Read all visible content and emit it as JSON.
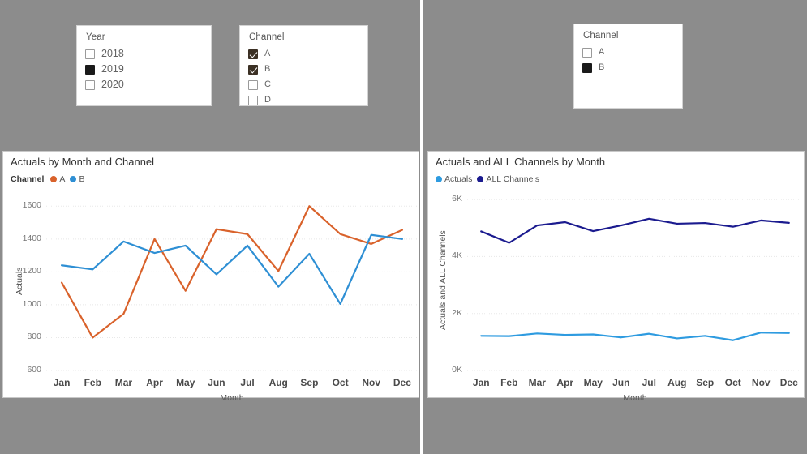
{
  "slicers": {
    "year": {
      "title": "Year",
      "items": [
        {
          "label": "2018",
          "state": "unchecked"
        },
        {
          "label": "2019",
          "state": "filled"
        },
        {
          "label": "2020",
          "state": "unchecked"
        }
      ]
    },
    "channel_left": {
      "title": "Channel",
      "items": [
        {
          "label": "A",
          "state": "checked"
        },
        {
          "label": "B",
          "state": "checked"
        },
        {
          "label": "C",
          "state": "unchecked"
        },
        {
          "label": "D",
          "state": "unchecked"
        }
      ]
    },
    "channel_right": {
      "title": "Channel",
      "items": [
        {
          "label": "A",
          "state": "unchecked"
        },
        {
          "label": "B",
          "state": "filled"
        }
      ]
    }
  },
  "colors": {
    "orange": "#D9622B",
    "blue": "#2E8FD4",
    "navy": "#1B1B8F",
    "lightblue": "#2E9BE0",
    "background": "#8c8c8c",
    "divider": "#ffffff"
  },
  "chart_data": [
    {
      "id": "actuals-by-month-and-channel",
      "type": "line",
      "title": "Actuals by Month and Channel",
      "legend_title": "Channel",
      "legend_position": "top-left",
      "grid": true,
      "xlabel": "Month",
      "ylabel": "Actuals",
      "categories": [
        "Jan",
        "Feb",
        "Mar",
        "Apr",
        "May",
        "Jun",
        "Jul",
        "Aug",
        "Sep",
        "Oct",
        "Nov",
        "Dec"
      ],
      "yticks": [
        600,
        800,
        1000,
        1200,
        1400,
        1600
      ],
      "ylim": [
        600,
        1700
      ],
      "series": [
        {
          "name": "A",
          "color": "#D9622B",
          "values": [
            1135,
            800,
            945,
            1400,
            1085,
            1460,
            1430,
            1205,
            1600,
            1430,
            1370,
            1455
          ]
        },
        {
          "name": "B",
          "color": "#2E8FD4",
          "values": [
            1240,
            1215,
            1385,
            1315,
            1360,
            1185,
            1360,
            1110,
            1310,
            1005,
            1425,
            1400
          ]
        }
      ]
    },
    {
      "id": "actuals-and-all-channels-by-month",
      "type": "line",
      "title": "Actuals and ALL Channels by Month",
      "legend_title": "",
      "legend_position": "top-left",
      "grid": true,
      "xlabel": "Month",
      "ylabel": "Actuals and ALL Channels",
      "categories": [
        "Jan",
        "Feb",
        "Mar",
        "Apr",
        "May",
        "Jun",
        "Jul",
        "Aug",
        "Sep",
        "Oct",
        "Nov",
        "Dec"
      ],
      "yticks": [
        "0K",
        "2K",
        "4K",
        "6K"
      ],
      "ytickvalues": [
        0,
        2000,
        4000,
        6000
      ],
      "ylim": [
        0,
        6400
      ],
      "series": [
        {
          "name": "Actuals",
          "color": "#2E9BE0",
          "values": [
            1215,
            1205,
            1300,
            1250,
            1265,
            1160,
            1290,
            1125,
            1215,
            1060,
            1330,
            1315
          ]
        },
        {
          "name": "ALL Channels",
          "color": "#1B1B8F",
          "values": [
            4880,
            4480,
            5090,
            5205,
            4890,
            5090,
            5325,
            5150,
            5175,
            5045,
            5265,
            5180
          ]
        }
      ]
    }
  ]
}
